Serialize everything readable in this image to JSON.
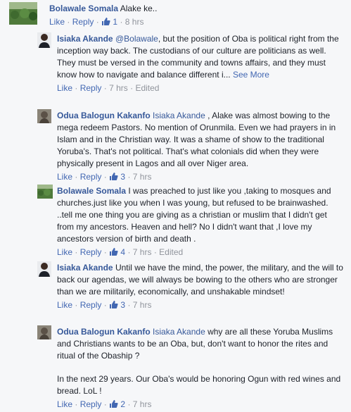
{
  "comments": [
    {
      "author": "Bolawale Somala",
      "mention": "",
      "text": "Alake ke..",
      "actions": {
        "like": "Like",
        "reply": "Reply",
        "count": "1",
        "time": "8 hrs",
        "edited": ""
      }
    },
    {
      "author": "Isiaka Akande",
      "mention": "@Bolawale",
      "text": ", but the position of Oba is political right from the inception way back. The custodians of our culture are politicians as well. They must be versed in the community and towns affairs, and they must know how to navigate and balance different i...",
      "see_more": "See More",
      "actions": {
        "like": "Like",
        "reply": "Reply",
        "count": "",
        "time": "7 hrs",
        "edited": "Edited"
      }
    },
    {
      "author": "Odua Balogun Kakanfo",
      "mention": "Isiaka Akande",
      "text": " , Alake was almost bowing to the mega redeem Pastors. No mention of Orunmila. Even we had prayers in in Islam and in the Christian way. It was a shame of show to the traditional Yoruba's. That's not political. That's what colonials did when they were physically present in Lagos and all over Niger area.",
      "actions": {
        "like": "Like",
        "reply": "Reply",
        "count": "3",
        "time": "7 hrs",
        "edited": ""
      }
    },
    {
      "author": "Bolawale Somala",
      "mention": "",
      "text": "I was preached to just like you ,taking to mosques and churches.just like you when I was young, but refused to be brainwashed. ..tell me one thing you are giving as a christian or muslim that I didn't get from my ancestors. Heaven and hell? No I didn't want that ,I love my ancestors version of birth and death .",
      "actions": {
        "like": "Like",
        "reply": "Reply",
        "count": "4",
        "time": "7 hrs",
        "edited": "Edited"
      }
    },
    {
      "author": "Isiaka Akande",
      "mention": "",
      "text": "Until we have the mind, the power, the military, and the will to back our agendas, we will always be bowing to the others who are stronger than we are militarily, economically, and unshakable mindset!",
      "actions": {
        "like": "Like",
        "reply": "Reply",
        "count": "3",
        "time": "7 hrs",
        "edited": ""
      }
    },
    {
      "author": "Odua Balogun Kakanfo",
      "mention": "Isiaka Akande",
      "text": " why are all these Yoruba Muslims and Christians wants to be an Oba, but, don't want to honor the rites and ritual of the Obaship ?",
      "text2": "In the next 29 years. Our Oba's would be honoring Ogun with red wines and bread. LoL !",
      "actions": {
        "like": "Like",
        "reply": "Reply",
        "count": "2",
        "time": "7 hrs",
        "edited": ""
      }
    }
  ],
  "colors": {
    "link": "#365899",
    "action": "#4267b2",
    "meta": "#90949c",
    "background": "#f6f7f9"
  },
  "sep": {
    "dot": "·"
  }
}
